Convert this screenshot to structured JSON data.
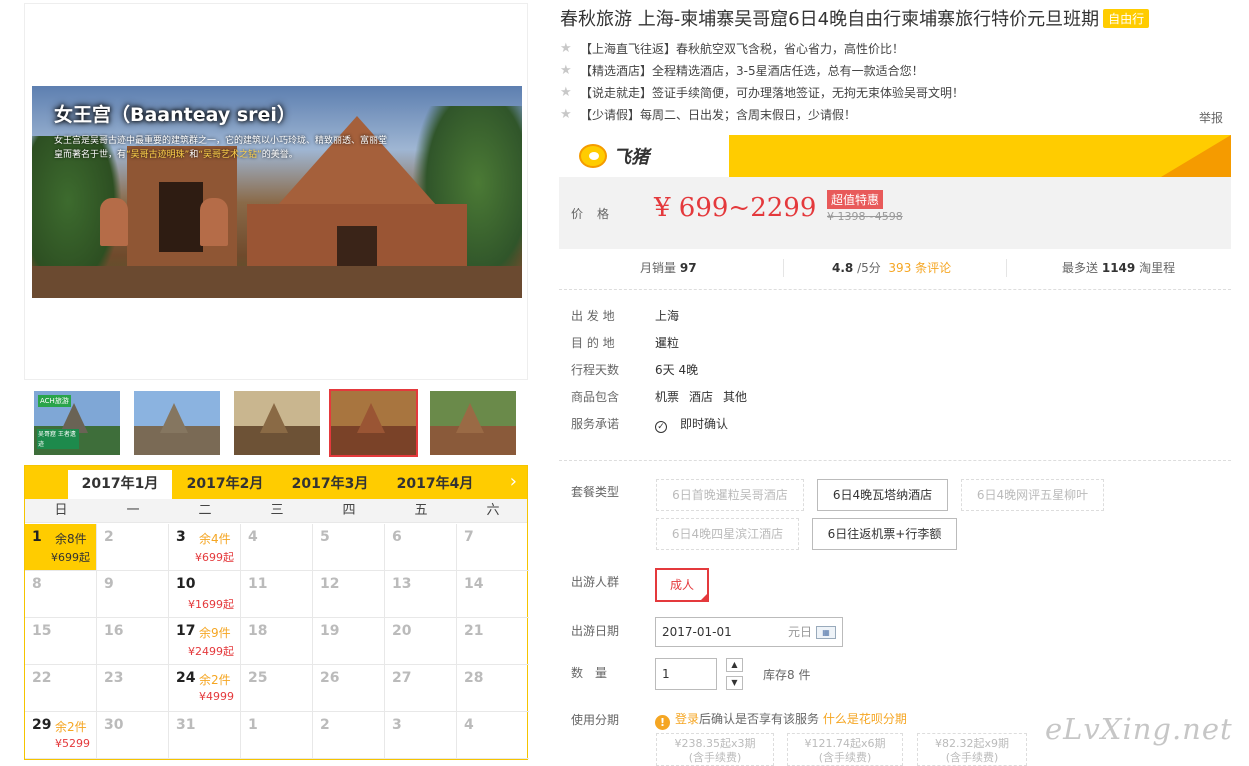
{
  "gallery": {
    "caption_title": "女王宫（Baanteay srei）",
    "caption_pre": "女王宫是吴哥古迹中最重要的建筑群之一，它的建筑以小巧玲珑、精致丽透、富丽堂皇而著名于世，有",
    "caption_q1": "“吴哥古迹明珠”",
    "caption_mid": "和",
    "caption_q2": "“吴哥艺术之钻”",
    "caption_post": "的美誉。",
    "thumb1_badge": "ACH旅游",
    "thumb1_overlay": "吴哥窟 王者遗迹"
  },
  "calendar": {
    "months": [
      "2017年1月",
      "2017年2月",
      "2017年3月",
      "2017年4月"
    ],
    "active_month": 0,
    "next_icon": "›",
    "weekdays": [
      "日",
      "一",
      "二",
      "三",
      "四",
      "五",
      "六"
    ],
    "days": [
      {
        "d": "1",
        "stock": "余8件",
        "price": "¥699起",
        "sel": true
      },
      {
        "d": "2"
      },
      {
        "d": "3",
        "stock": "余4件",
        "price": "¥699起"
      },
      {
        "d": "4"
      },
      {
        "d": "5"
      },
      {
        "d": "6"
      },
      {
        "d": "7"
      },
      {
        "d": "8"
      },
      {
        "d": "9"
      },
      {
        "d": "10",
        "price": "¥1699起"
      },
      {
        "d": "11"
      },
      {
        "d": "12"
      },
      {
        "d": "13"
      },
      {
        "d": "14"
      },
      {
        "d": "15"
      },
      {
        "d": "16"
      },
      {
        "d": "17",
        "stock": "余9件",
        "price": "¥2499起"
      },
      {
        "d": "18"
      },
      {
        "d": "19"
      },
      {
        "d": "20"
      },
      {
        "d": "21"
      },
      {
        "d": "22"
      },
      {
        "d": "23"
      },
      {
        "d": "24",
        "stock": "余2件",
        "price": "¥4999"
      },
      {
        "d": "25"
      },
      {
        "d": "26"
      },
      {
        "d": "27"
      },
      {
        "d": "28"
      },
      {
        "d": "29",
        "stock": "余2件",
        "price": "¥5299"
      },
      {
        "d": "30"
      },
      {
        "d": "31"
      },
      {
        "d": "1"
      },
      {
        "d": "2"
      },
      {
        "d": "3"
      },
      {
        "d": "4"
      }
    ]
  },
  "product": {
    "title": "春秋旅游 上海-柬埔寨吴哥窟6日4晚自由行柬埔寨旅行特价元旦班期",
    "tag": "自由行",
    "features": [
      "【上海直飞往返】春秋航空双飞含税，省心省力，高性价比！",
      "【精选酒店】全程精选酒店，3-5星酒店任选，总有一款适合您！",
      "【说走就走】签证手续简便，可办理落地签证，无拘无束体验吴哥文明！",
      "【少请假】每周二、日出发；含周末假日，少请假！"
    ],
    "report": "举报",
    "brand": "飞猪",
    "price_label": "价格",
    "price": "¥ 699~2299",
    "price_badge": "超值特惠",
    "price_old": "¥ 1398~4598",
    "monthly_sales_label": "月销量",
    "monthly_sales": "97",
    "rating": "4.8",
    "rating_suffix": "/5分",
    "reviews": "393 条评论",
    "mileage_pre": "最多送",
    "mileage": "1149",
    "mileage_post": "淘里程"
  },
  "info": {
    "rows": [
      {
        "k": "出 发 地",
        "v": "上海"
      },
      {
        "k": "目 的 地",
        "v": "暹粒"
      },
      {
        "k": "行程天数",
        "v": "6天 4晚"
      }
    ],
    "includes_label": "商品包含",
    "includes": [
      "机票",
      "酒店",
      "其他"
    ],
    "service_label": "服务承诺",
    "service": "即时确认"
  },
  "options": {
    "package_label": "套餐类型",
    "packages": [
      {
        "label": "6日首晚暹粒吴哥酒店",
        "enabled": false
      },
      {
        "label": "6日4晚瓦塔纳酒店",
        "enabled": true
      },
      {
        "label": "6日4晚网评五星柳叶",
        "enabled": false
      },
      {
        "label": "6日4晚四星滨江酒店",
        "enabled": false
      },
      {
        "label": "6日往返机票+行李额",
        "enabled": true
      }
    ],
    "crowd_label": "出游人群",
    "crowd": "成人",
    "date_label": "出游日期",
    "date": "2017-01-01",
    "holiday": "元日",
    "qty_label": "数　量",
    "qty": "1",
    "stock": "库存8 件",
    "installment_label": "使用分期",
    "login_link": "登录",
    "install_text": "后确认是否享有该服务",
    "install_link": "什么是花呗分期",
    "installments": [
      {
        "amt": "¥238.35起x3期",
        "fee": "(含手续费)"
      },
      {
        "amt": "¥121.74起x6期",
        "fee": "(含手续费)"
      },
      {
        "amt": "¥82.32起x9期",
        "fee": "(含手续费)"
      }
    ]
  },
  "watermark": "eLvXing.net"
}
